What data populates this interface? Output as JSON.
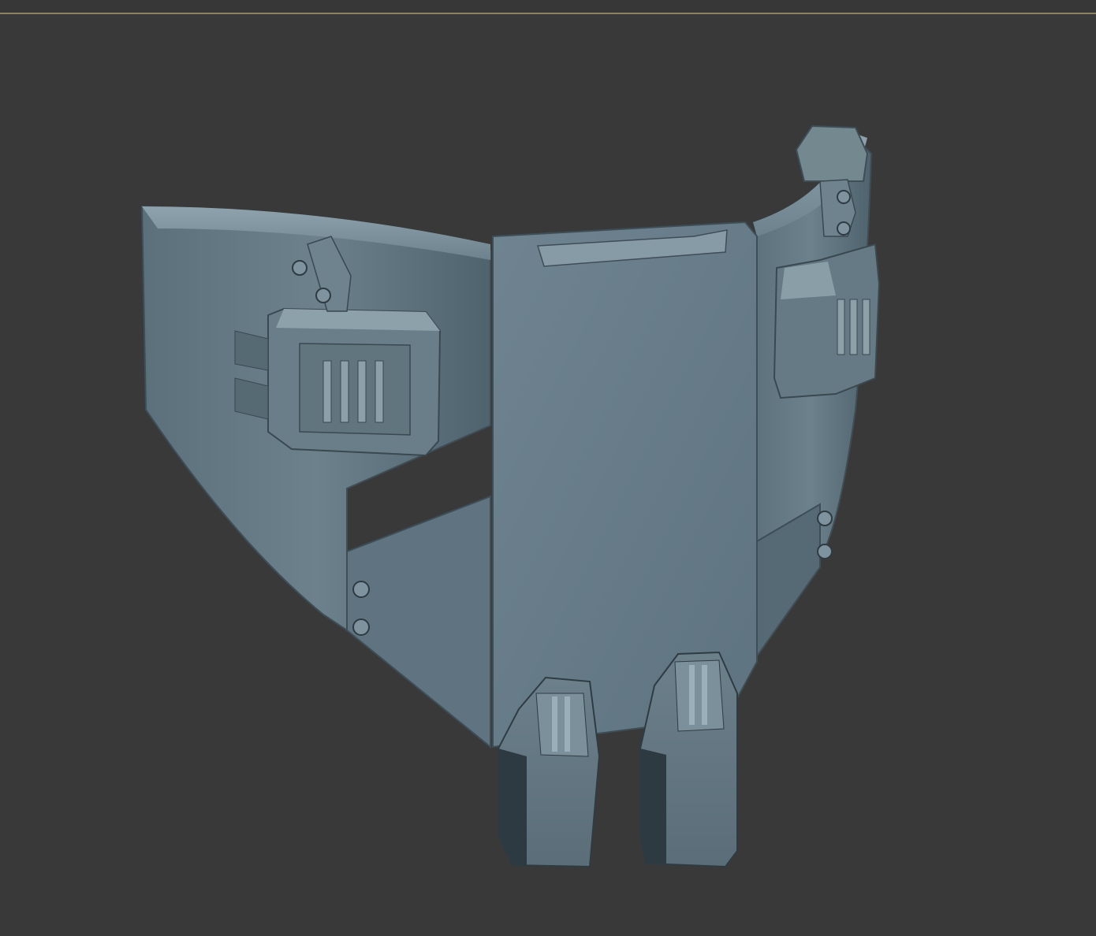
{
  "viewport": {
    "background_color": "#393939",
    "border_color": "#8c8460",
    "active": true
  },
  "model": {
    "object": "armor-waist-plate",
    "base_color": "#6a7f8a",
    "shadow_color": "#3f4f58",
    "highlight_color": "#8ea2ad",
    "edge_color": "#a9bcc6"
  }
}
